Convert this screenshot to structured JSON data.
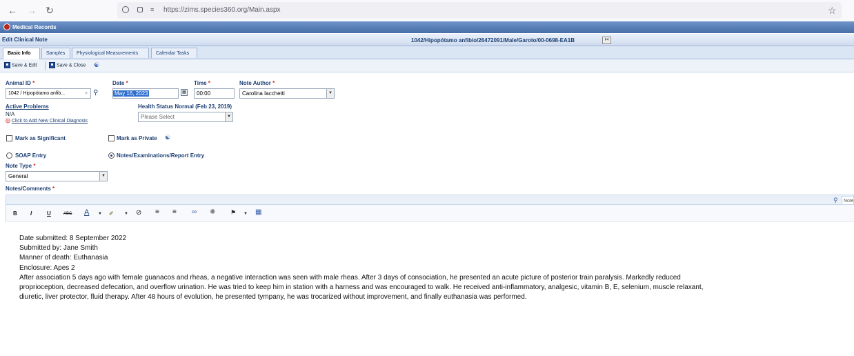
{
  "browser": {
    "url": "https://zims.species360.org/Main.aspx"
  },
  "app": {
    "title": "Medical Records",
    "subtitle": "Edit Clinical Note",
    "record_id": "1042/Hipopótamo anfibio/26472091/Male/Garoto/00-0698-EA1B",
    "f4_label": "F4"
  },
  "tabs": [
    "Basic Info",
    "Samples",
    "Physiological Measurements",
    "Calendar Tasks"
  ],
  "toolbar": {
    "save_edit": "Save & Edit",
    "save_close": "Save & Close"
  },
  "form": {
    "animal_id_label": "Animal ID",
    "animal_id_value": "1042 / Hipopótamo anfib...",
    "date_label": "Date",
    "date_value": "May 16, 2023",
    "time_label": "Time",
    "time_value": "00:00",
    "author_label": "Note Author",
    "author_value": "Carolina Iacchetti",
    "active_problems_label": "Active Problems",
    "active_problems_value": "N/A",
    "add_diagnosis_link": "Click to Add New Clinical Diagnosis",
    "health_status_label": "Health Status Normal (Feb 23, 2019)",
    "health_status_placeholder": "Please Select",
    "mark_significant": "Mark as Significant",
    "mark_private": "Mark as Private",
    "soap_entry": "SOAP Entry",
    "notes_entry": "Notes/Examinations/Report Entry",
    "note_type_label": "Note Type",
    "note_type_value": "General",
    "notes_label": "Notes/Comments",
    "required_mark": "*"
  },
  "editor": {
    "notes_tab_label": "Note",
    "lines": [
      "Date submitted: 8 September 2022",
      "Submitted by: Jane Smith",
      "Manner of death: Euthanasia",
      "Enclosure: Apes 2",
      "After association 5 days ago with female guanacos and rheas, a negative interaction was seen with male rheas. After 3 days of consociation, he presented an acute picture of posterior train paralysis. Markedly reduced proprioception, decreased defecation, and overflow urination. He was tried to keep him in station with a harness and was encouraged to walk. He received anti-inflammatory, analgesic, vitamin B, E, selenium, muscle relaxant, diuretic, liver protector, fluid therapy. After 48 hours of evolution, he presented tympany, he was trocarized without improvement, and finally euthanasia was performed."
    ]
  }
}
